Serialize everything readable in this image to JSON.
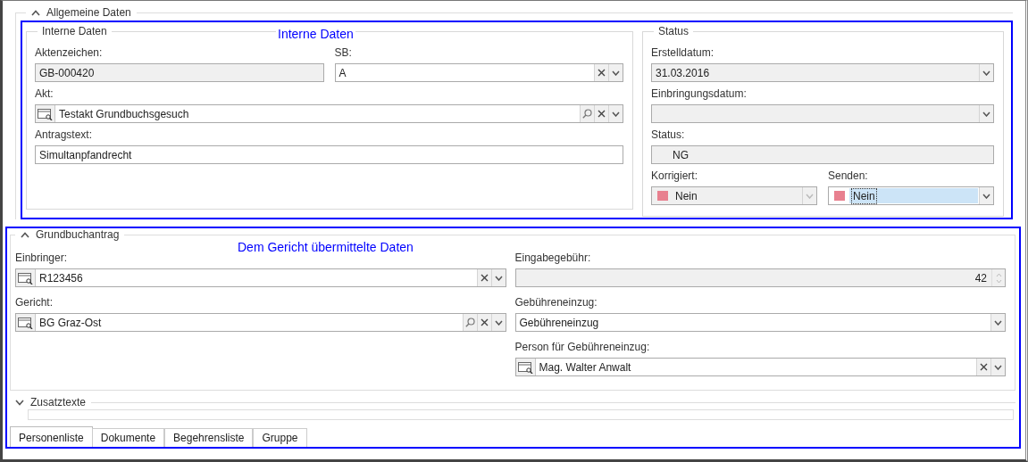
{
  "general": {
    "title": "Allgemeine Daten",
    "expanded": true,
    "annotation": "Interne Daten",
    "internal": {
      "title": "Interne Daten",
      "rows": [
        [
          {
            "label": "Aktenzeichen:",
            "value": "GB-000420",
            "kind": "text",
            "disabled": true
          },
          {
            "label": "SB:",
            "value": "A",
            "kind": "combo",
            "disabled": false,
            "clear": true
          }
        ],
        [
          {
            "label": "Akt:",
            "value": "Testakt Grundbuchsgesuch",
            "kind": "lookup",
            "disabled": false,
            "search": true,
            "clear": true
          }
        ],
        [
          {
            "label": "Antragstext:",
            "value": "Simultanpfandrecht",
            "kind": "text",
            "disabled": false
          }
        ]
      ]
    },
    "status": {
      "title": "Status",
      "rows": [
        [
          {
            "label": "Erstelldatum:",
            "value": "31.03.2016",
            "kind": "combo",
            "disabled": true
          }
        ],
        [
          {
            "label": "Einbringungsdatum:",
            "kind": "combo",
            "disabled": true
          }
        ],
        [
          {
            "label": "Status:",
            "value": "NG",
            "kind": "text",
            "disabled": true,
            "indent": true
          }
        ],
        [
          {
            "label": "Korrigiert:",
            "value": "Nein",
            "kind": "color-combo",
            "disabled": true,
            "color": "#e8808f"
          },
          {
            "label": "Senden:",
            "value": "Nein",
            "kind": "color-combo",
            "disabled": false,
            "focused": true,
            "color": "#e8808f"
          }
        ]
      ]
    }
  },
  "application": {
    "title": "Grundbuchantrag",
    "expanded": true,
    "annotation": "Dem Gericht übermittelte Daten",
    "columns": [
      [
        {
          "label": "Einbringer:",
          "value": "R123456",
          "kind": "lookup",
          "disabled": false,
          "clear": true
        },
        {
          "label": "Gericht:",
          "value": "BG Graz-Ost",
          "kind": "lookup",
          "disabled": false,
          "search": true,
          "clear": true
        }
      ],
      [
        {
          "label": "Eingabegebühr:",
          "value": "42",
          "kind": "spin",
          "disabled": true
        },
        {
          "label": "Gebühreneinzug:",
          "value": "Gebühreneinzug",
          "kind": "combo",
          "disabled": false
        },
        {
          "label": "Person für Gebühreneinzug:",
          "value": "Mag. Walter Anwalt",
          "kind": "lookup",
          "disabled": false,
          "clear": true
        }
      ]
    ]
  },
  "extra": {
    "title": "Zusatztexte",
    "expanded": false
  },
  "tabs": [
    {
      "label": "Personenliste",
      "selected": true
    },
    {
      "label": "Dokumente",
      "selected": false
    },
    {
      "label": "Begehrensliste",
      "selected": false
    },
    {
      "label": "Gruppe",
      "selected": false
    }
  ]
}
